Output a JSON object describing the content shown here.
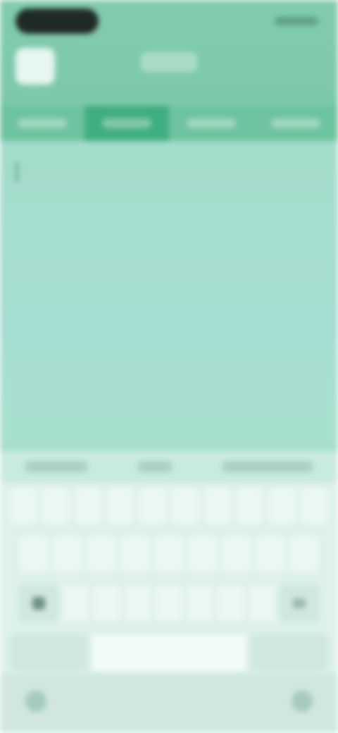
{
  "app": {
    "title": ""
  },
  "colors": {
    "header": "#82ccae",
    "tab_active": "#3fae7f",
    "content": "#a4dccb",
    "keyboard": "#ddf0eb"
  },
  "tabs": [
    {
      "label": ""
    },
    {
      "label": ""
    },
    {
      "label": ""
    },
    {
      "label": ""
    }
  ],
  "suggestions": [
    "",
    "",
    ""
  ],
  "keyboard": {
    "row1": [
      "",
      "",
      "",
      "",
      "",
      "",
      "",
      "",
      "",
      ""
    ],
    "row2": [
      "",
      "",
      "",
      "",
      "",
      "",
      "",
      "",
      ""
    ],
    "row3": [
      "shift-icon",
      "",
      "",
      "",
      "",
      "",
      "",
      "",
      "backspace-icon"
    ],
    "bottom": [
      "",
      "",
      ""
    ]
  },
  "nav": {
    "left_icon": "back-icon",
    "right_icon": "keyboard-icon"
  }
}
